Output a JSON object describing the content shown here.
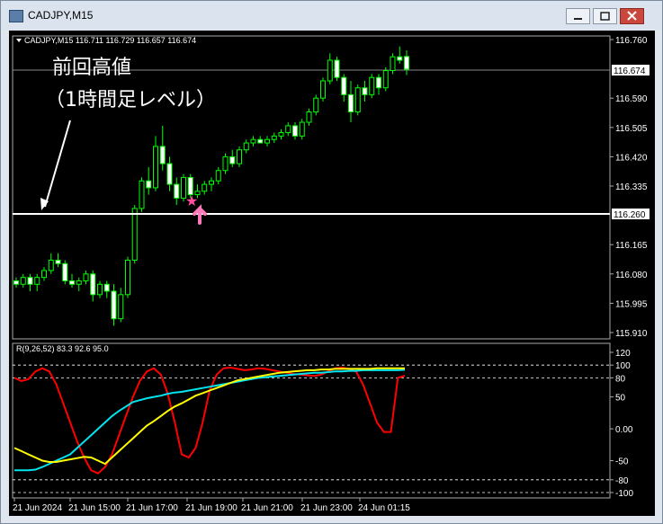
{
  "window": {
    "title": "CADJPY,M15"
  },
  "chart_data": [
    {
      "type": "candlestick",
      "title": "",
      "symbol_header": "CADJPY,M15  116.711 116.729 116.657 116.674",
      "price_axis": {
        "ticks": [
          "116.760",
          "116.674",
          "116.590",
          "116.505",
          "116.420",
          "116.335",
          "116.260",
          "116.165",
          "116.080",
          "115.995",
          "115.910"
        ]
      },
      "ylim": [
        115.91,
        116.76
      ],
      "current_price": "116.674",
      "level_price": "116.260",
      "annotation_line1": "前回高値",
      "annotation_line2": "（1時間足レベル）",
      "candles": [
        {
          "o": 116.06,
          "h": 116.07,
          "l": 116.04,
          "c": 116.05
        },
        {
          "o": 116.05,
          "h": 116.08,
          "l": 116.04,
          "c": 116.07
        },
        {
          "o": 116.07,
          "h": 116.08,
          "l": 116.03,
          "c": 116.05
        },
        {
          "o": 116.05,
          "h": 116.08,
          "l": 116.03,
          "c": 116.07
        },
        {
          "o": 116.07,
          "h": 116.1,
          "l": 116.06,
          "c": 116.09
        },
        {
          "o": 116.09,
          "h": 116.14,
          "l": 116.08,
          "c": 116.12
        },
        {
          "o": 116.12,
          "h": 116.14,
          "l": 116.1,
          "c": 116.11
        },
        {
          "o": 116.11,
          "h": 116.12,
          "l": 116.05,
          "c": 116.06
        },
        {
          "o": 116.06,
          "h": 116.08,
          "l": 116.04,
          "c": 116.05
        },
        {
          "o": 116.05,
          "h": 116.07,
          "l": 116.03,
          "c": 116.06
        },
        {
          "o": 116.06,
          "h": 116.09,
          "l": 116.05,
          "c": 116.08
        },
        {
          "o": 116.08,
          "h": 116.09,
          "l": 116.0,
          "c": 116.02
        },
        {
          "o": 116.02,
          "h": 116.06,
          "l": 116.01,
          "c": 116.05
        },
        {
          "o": 116.05,
          "h": 116.06,
          "l": 116.01,
          "c": 116.03
        },
        {
          "o": 116.03,
          "h": 116.05,
          "l": 115.93,
          "c": 115.95
        },
        {
          "o": 115.95,
          "h": 116.04,
          "l": 115.94,
          "c": 116.02
        },
        {
          "o": 116.02,
          "h": 116.13,
          "l": 116.01,
          "c": 116.12
        },
        {
          "o": 116.12,
          "h": 116.28,
          "l": 116.11,
          "c": 116.27
        },
        {
          "o": 116.27,
          "h": 116.36,
          "l": 116.26,
          "c": 116.35
        },
        {
          "o": 116.35,
          "h": 116.39,
          "l": 116.31,
          "c": 116.33
        },
        {
          "o": 116.33,
          "h": 116.48,
          "l": 116.32,
          "c": 116.45
        },
        {
          "o": 116.45,
          "h": 116.51,
          "l": 116.38,
          "c": 116.4
        },
        {
          "o": 116.4,
          "h": 116.42,
          "l": 116.32,
          "c": 116.34
        },
        {
          "o": 116.34,
          "h": 116.36,
          "l": 116.28,
          "c": 116.3
        },
        {
          "o": 116.3,
          "h": 116.37,
          "l": 116.29,
          "c": 116.36
        },
        {
          "o": 116.36,
          "h": 116.37,
          "l": 116.3,
          "c": 116.31
        },
        {
          "o": 116.31,
          "h": 116.34,
          "l": 116.3,
          "c": 116.32
        },
        {
          "o": 116.32,
          "h": 116.35,
          "l": 116.31,
          "c": 116.34
        },
        {
          "o": 116.34,
          "h": 116.36,
          "l": 116.32,
          "c": 116.35
        },
        {
          "o": 116.35,
          "h": 116.39,
          "l": 116.34,
          "c": 116.38
        },
        {
          "o": 116.38,
          "h": 116.43,
          "l": 116.37,
          "c": 116.42
        },
        {
          "o": 116.42,
          "h": 116.44,
          "l": 116.39,
          "c": 116.4
        },
        {
          "o": 116.4,
          "h": 116.45,
          "l": 116.39,
          "c": 116.44
        },
        {
          "o": 116.44,
          "h": 116.47,
          "l": 116.43,
          "c": 116.46
        },
        {
          "o": 116.46,
          "h": 116.48,
          "l": 116.45,
          "c": 116.47
        },
        {
          "o": 116.47,
          "h": 116.48,
          "l": 116.46,
          "c": 116.46
        },
        {
          "o": 116.46,
          "h": 116.48,
          "l": 116.45,
          "c": 116.47
        },
        {
          "o": 116.47,
          "h": 116.49,
          "l": 116.46,
          "c": 116.48
        },
        {
          "o": 116.48,
          "h": 116.5,
          "l": 116.47,
          "c": 116.49
        },
        {
          "o": 116.49,
          "h": 116.52,
          "l": 116.48,
          "c": 116.51
        },
        {
          "o": 116.51,
          "h": 116.52,
          "l": 116.47,
          "c": 116.48
        },
        {
          "o": 116.48,
          "h": 116.53,
          "l": 116.47,
          "c": 116.52
        },
        {
          "o": 116.52,
          "h": 116.56,
          "l": 116.51,
          "c": 116.55
        },
        {
          "o": 116.55,
          "h": 116.6,
          "l": 116.54,
          "c": 116.59
        },
        {
          "o": 116.59,
          "h": 116.65,
          "l": 116.58,
          "c": 116.64
        },
        {
          "o": 116.64,
          "h": 116.72,
          "l": 116.63,
          "c": 116.7
        },
        {
          "o": 116.7,
          "h": 116.71,
          "l": 116.64,
          "c": 116.65
        },
        {
          "o": 116.65,
          "h": 116.66,
          "l": 116.58,
          "c": 116.6
        },
        {
          "o": 116.6,
          "h": 116.64,
          "l": 116.52,
          "c": 116.55
        },
        {
          "o": 116.55,
          "h": 116.63,
          "l": 116.54,
          "c": 116.62
        },
        {
          "o": 116.62,
          "h": 116.64,
          "l": 116.58,
          "c": 116.6
        },
        {
          "o": 116.6,
          "h": 116.66,
          "l": 116.59,
          "c": 116.65
        },
        {
          "o": 116.65,
          "h": 116.66,
          "l": 116.6,
          "c": 116.62
        },
        {
          "o": 116.62,
          "h": 116.68,
          "l": 116.61,
          "c": 116.67
        },
        {
          "o": 116.67,
          "h": 116.72,
          "l": 116.66,
          "c": 116.71
        },
        {
          "o": 116.71,
          "h": 116.74,
          "l": 116.69,
          "c": 116.7
        },
        {
          "o": 116.711,
          "h": 116.729,
          "l": 116.657,
          "c": 116.674
        }
      ]
    },
    {
      "type": "line",
      "title": "",
      "indicator_header": "R(9,26,52) 83.3 92.6 95.0",
      "ylim": [
        -100,
        120
      ],
      "y_ticks": [
        "120",
        "100",
        "80",
        "50",
        "0.00",
        "-50",
        "-80",
        "-100"
      ],
      "x_labels": [
        "21 Jun 2024",
        "21 Jun 15:00",
        "21 Jun 17:00",
        "21 Jun 19:00",
        "21 Jun 21:00",
        "21 Jun 23:00",
        "24 Jun 01:15"
      ],
      "series": [
        {
          "color": "#ff0000",
          "values": [
            80,
            75,
            78,
            90,
            95,
            90,
            70,
            40,
            10,
            -20,
            -45,
            -65,
            -70,
            -60,
            -40,
            -10,
            20,
            50,
            75,
            90,
            95,
            85,
            55,
            10,
            -40,
            -45,
            -30,
            10,
            60,
            85,
            95,
            96,
            94,
            92,
            93,
            95,
            94,
            92,
            90,
            88,
            86,
            85,
            84,
            83,
            85,
            90,
            95,
            96,
            94,
            90,
            70,
            40,
            10,
            -5,
            -5,
            80,
            83.3
          ]
        },
        {
          "color": "#00e5ee",
          "values": [
            -65,
            -65,
            -65,
            -64,
            -60,
            -55,
            -50,
            -45,
            -40,
            -30,
            -20,
            -10,
            0,
            10,
            20,
            28,
            35,
            42,
            45,
            48,
            50,
            52,
            55,
            57,
            58,
            60,
            62,
            64,
            66,
            68,
            70,
            72,
            74,
            76,
            78,
            80,
            81,
            82,
            83,
            84,
            85,
            86,
            87,
            88,
            88,
            89,
            90,
            90,
            91,
            91,
            92,
            92,
            92,
            92,
            92,
            92,
            92.6
          ]
        },
        {
          "color": "#ffff00",
          "values": [
            -30,
            -35,
            -40,
            -45,
            -50,
            -52,
            -52,
            -50,
            -48,
            -46,
            -44,
            -45,
            -50,
            -55,
            -45,
            -35,
            -25,
            -15,
            -5,
            5,
            12,
            20,
            28,
            35,
            40,
            46,
            52,
            56,
            60,
            64,
            68,
            72,
            76,
            78,
            80,
            82,
            84,
            86,
            88,
            89,
            90,
            91,
            92,
            92,
            93,
            93,
            94,
            94,
            94,
            94,
            94,
            94,
            95,
            95,
            95,
            95,
            95.0
          ]
        }
      ]
    }
  ]
}
